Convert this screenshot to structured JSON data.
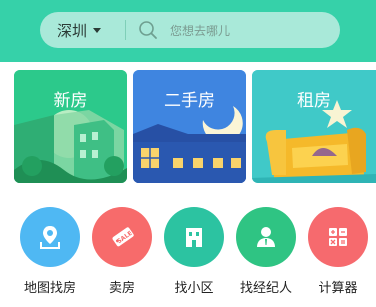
{
  "header": {
    "city": "深圳",
    "search_placeholder": "您想去哪儿"
  },
  "cards": [
    {
      "label": "新房",
      "icon": "new-house-illustration"
    },
    {
      "label": "二手房",
      "icon": "night-house-illustration"
    },
    {
      "label": "租房",
      "icon": "sofa-illustration"
    }
  ],
  "nav": [
    {
      "label": "地图找房",
      "icon": "map-pin-icon",
      "color": "#4fb8f3"
    },
    {
      "label": "卖房",
      "icon": "sale-tag-icon",
      "color": "#f76b6b"
    },
    {
      "label": "找小区",
      "icon": "building-icon",
      "color": "#2cc3a1"
    },
    {
      "label": "找经纪人",
      "icon": "agent-icon",
      "color": "#2fc483"
    },
    {
      "label": "计算器",
      "icon": "calculator-icon",
      "color": "#f66a6e"
    }
  ],
  "colors": {
    "header": "#36d1a9",
    "search_bar": "#a9e9d9"
  }
}
